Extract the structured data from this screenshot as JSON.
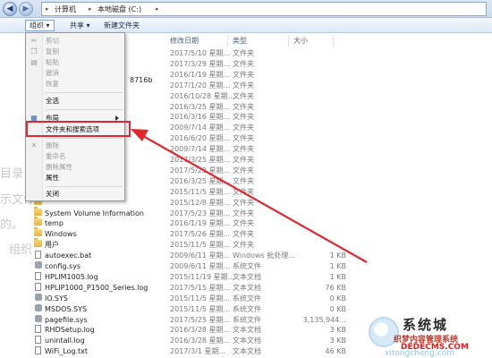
{
  "address": {
    "crumbs": [
      "计算机",
      "本地磁盘 (C:)"
    ]
  },
  "toolbar": {
    "organize": "组织 ▾",
    "share": "共享 ▾",
    "new_folder": "新建文件夹"
  },
  "columns": {
    "date": "修改日期",
    "type": "类型",
    "size": "大小"
  },
  "ghost_text": [
    "目录",
    "示文件",
    "的。",
    "组织"
  ],
  "partial_name": "8716b",
  "rows": [
    {
      "name": "",
      "date": "2017/5/10 星期...",
      "type": "文件夹",
      "size": "",
      "icon": "folder-icon"
    },
    {
      "name": "",
      "date": "2017/3/29 星期...",
      "type": "文件夹",
      "size": "",
      "icon": "folder-icon"
    },
    {
      "name": "",
      "date": "2016/1/19 星期...",
      "type": "文件夹",
      "size": "",
      "icon": "folder-icon"
    },
    {
      "name": "",
      "date": "2017/1/20 星期...",
      "type": "文件夹",
      "size": "",
      "icon": "folder-icon"
    },
    {
      "name": "",
      "date": "2016/10/28 星期...",
      "type": "文件夹",
      "size": "",
      "icon": "folder-icon"
    },
    {
      "name": "",
      "date": "2016/3/25 星期...",
      "type": "文件夹",
      "size": "",
      "icon": "folder-icon"
    },
    {
      "name": "",
      "date": "2016/3/16 星期...",
      "type": "文件夹",
      "size": "",
      "icon": "folder-icon"
    },
    {
      "name": "",
      "date": "2009/7/14 星期...",
      "type": "文件夹",
      "size": "",
      "icon": "folder-icon"
    },
    {
      "name": "",
      "date": "2016/6/20 星期...",
      "type": "文件夹",
      "size": "",
      "icon": "folder-icon"
    },
    {
      "name": "",
      "date": "2009/7/14 星期...",
      "type": "文件夹",
      "size": "",
      "icon": "folder-icon"
    },
    {
      "name": "",
      "date": "2017/3/25 星期...",
      "type": "文件夹",
      "size": "",
      "icon": "folder-icon"
    },
    {
      "name": "",
      "date": "2017/5/23 星期...",
      "type": "文件夹",
      "size": "",
      "icon": "folder-icon"
    },
    {
      "name": "",
      "date": "2016/3/25 星期...",
      "type": "文件夹",
      "size": "",
      "icon": "folder-icon"
    },
    {
      "name": "",
      "date": "2015/11/5 星期...",
      "type": "文件夹",
      "size": "",
      "icon": "folder-icon"
    },
    {
      "name": "",
      "date": "2015/12/8 星期...",
      "type": "文件夹",
      "size": "",
      "icon": "folder-icon"
    },
    {
      "name": "System Volume Information",
      "date": "2017/5/23 星期...",
      "type": "文件夹",
      "size": "",
      "icon": "folder-icon"
    },
    {
      "name": "temp",
      "date": "2016/1/19 星期...",
      "type": "文件夹",
      "size": "",
      "icon": "folder-icon"
    },
    {
      "name": "Windows",
      "date": "2017/5/26 星期...",
      "type": "文件夹",
      "size": "",
      "icon": "folder-icon"
    },
    {
      "name": "用户",
      "date": "2015/11/5 星期...",
      "type": "文件夹",
      "size": "",
      "icon": "folder-icon"
    },
    {
      "name": "autoexec.bat",
      "date": "2009/6/11 星期...",
      "type": "Windows 批处理...",
      "size": "1 KB",
      "icon": "doc-icon"
    },
    {
      "name": "config.sys",
      "date": "2009/6/11 星期...",
      "type": "系统文件",
      "size": "1 KB",
      "icon": "gear-icon"
    },
    {
      "name": "HPLIM1005.log",
      "date": "2015/11/19 星期...",
      "type": "文本文档",
      "size": "1 KB",
      "icon": "doc-icon"
    },
    {
      "name": "HPLIP1000_P1500_Series.log",
      "date": "2017/5/15 星期...",
      "type": "文本文档",
      "size": "76 KB",
      "icon": "doc-icon"
    },
    {
      "name": "IO.SYS",
      "date": "2015/11/5 星期...",
      "type": "系统文件",
      "size": "0 KB",
      "icon": "gear-icon"
    },
    {
      "name": "MSDOS.SYS",
      "date": "2015/11/5 星期...",
      "type": "系统文件",
      "size": "0 KB",
      "icon": "gear-icon"
    },
    {
      "name": "pagefile.sys",
      "date": "2017/5/25 星期...",
      "type": "系统文件",
      "size": "3,135,944...",
      "icon": "gear-icon"
    },
    {
      "name": "RHDSetup.log",
      "date": "2016/3/28 星期...",
      "type": "文本文档",
      "size": "3 KB",
      "icon": "doc-icon"
    },
    {
      "name": "unintall.log",
      "date": "2016/3/28 星期...",
      "type": "文本文档",
      "size": "3 KB",
      "icon": "doc-icon"
    },
    {
      "name": "WiFi_Log.txt",
      "date": "2017/3/1 星期...",
      "type": "文本文档",
      "size": "46 KB",
      "icon": "doc-icon"
    }
  ],
  "menu": {
    "cut": "剪切",
    "copy": "复制",
    "paste": "粘贴",
    "undo": "撤消",
    "redo": "恢复",
    "select_all": "全选",
    "layout": "布局",
    "folder_options": "文件夹和搜索选项",
    "delete": "删除",
    "rename": "重命名",
    "remove_properties": "删除属性",
    "properties": "属性",
    "close": "关闭"
  },
  "watermark": {
    "title": "系统城",
    "subtitle": "织梦内容管理系统",
    "url": "DEDECMS.COM",
    "pinyin": "xitongcheng.com"
  },
  "colors": {
    "highlight": "#e3262d",
    "arrow": "#e3262d",
    "toolbar_bg": "#dde8f4"
  }
}
